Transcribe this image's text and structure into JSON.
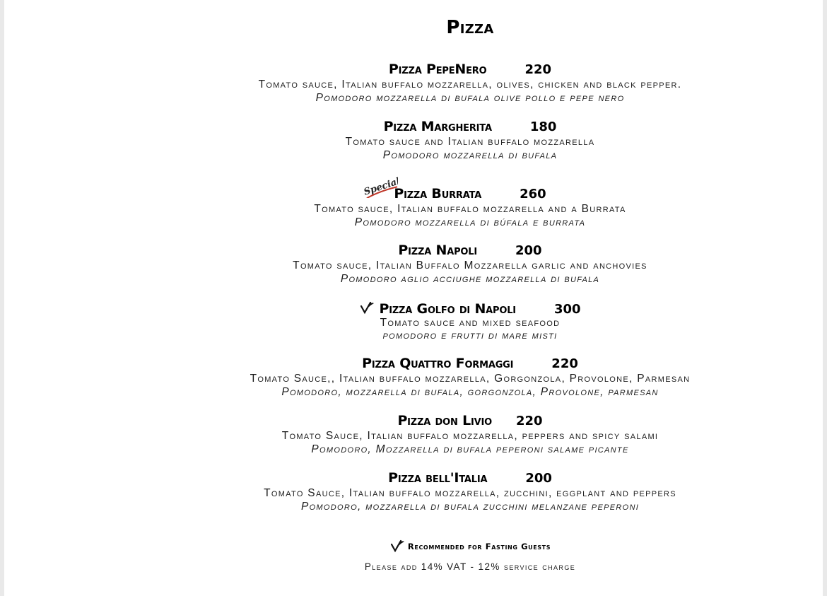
{
  "menu": {
    "title": "Pizza",
    "items": [
      {
        "name": "Pizza PepeNero",
        "price": "220",
        "description": "Tomato sauce, Italian buffalo mozzarella, olives, chicken and black pepper.",
        "italian": "Pomodoro mozzarella di bufala olive pollo e pepe nero"
      },
      {
        "name": "Pizza Margherita",
        "price": "180",
        "description": "Tomato sauce and Italian buffalo mozzarella",
        "italian": "Pomodoro mozzarella di bufala"
      },
      {
        "name": "Pizza Burrata",
        "price": "260",
        "description": "Tomato sauce, Italian buffalo mozzarella and a Burrata",
        "italian": "Pomodoro mozzarella di búfala e burrata",
        "badge": "Speciale"
      },
      {
        "name": "Pizza Napoli",
        "price": "200",
        "description": "Tomato sauce, Italian Buffalo Mozzarella garlic and anchovies",
        "italian": "Pomodoro aglio acciughe mozzarella di bufala"
      },
      {
        "name": "Pizza Golfo di Napoli",
        "price": "300",
        "description": "Tomato sauce and mixed seafood",
        "italian": "pomodoro e frutti di mare misti",
        "icon": "fasting-leaf-icon"
      },
      {
        "name": "Pizza Quattro Formaggi",
        "price": "220",
        "description": "Tomato Sauce,, Italian buffalo mozzarella, Gorgonzola, Provolone, Parmesan",
        "italian": "Pomodoro, mozzarella di bufala, gorgonzola, Provolone, parmesan"
      },
      {
        "name": "Pizza don Livio",
        "price": "220",
        "description": "Tomato Sauce, Italian buffalo mozzarella, peppers and spicy salami",
        "italian": "Pomodoro, Mozzarella di bufala peperoni salame picante"
      },
      {
        "name": "Pizza bell'Italia",
        "price": "200",
        "description": "Tomato Sauce, Italian buffalo mozzarella, zucchini, eggplant and peppers",
        "italian": "Pomodoro, mozzarella di bufala zucchini melanzane peperoni"
      }
    ],
    "footer": {
      "legend": "Recommended for Fasting Guests",
      "legend_icon": "fasting-leaf-icon",
      "vat_note": "Please add 14% VAT - 12% service charge"
    }
  },
  "colors": {
    "text": "#000000",
    "badge_red": "#c0392b",
    "page_bg": "#ffffff",
    "frame_bg": "#e9e9e9"
  }
}
